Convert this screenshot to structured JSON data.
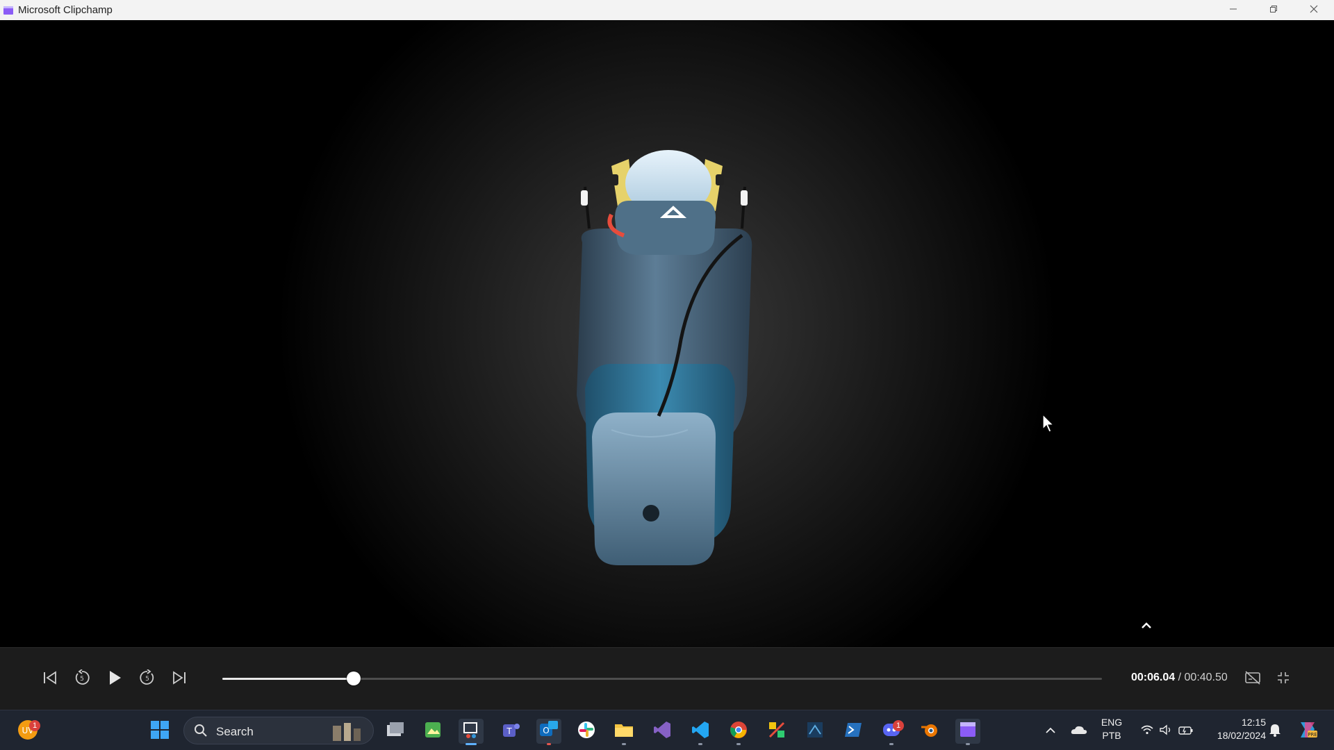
{
  "window": {
    "title": "Microsoft Clipchamp",
    "icon": "clipchamp-icon",
    "controls": [
      "minimize-icon",
      "restore-icon",
      "close-icon"
    ]
  },
  "player": {
    "current_time": "00:06.04",
    "separator": " / ",
    "total_time": "00:40.50",
    "progress": 0.149,
    "buttons": [
      "skip-back-icon",
      "rewind-5-icon",
      "play-icon",
      "forward-5-icon",
      "skip-forward-icon",
      "captions-off-icon",
      "exit-fullscreen-icon"
    ]
  },
  "taskbar": {
    "weather_badge": "1",
    "search_placeholder": "Search",
    "apps": [
      "start-icon",
      "task-view-icon",
      "photos-icon",
      "snipping-tool-icon",
      "teams-icon",
      "outlook-new-icon",
      "slack-icon",
      "file-explorer-icon",
      "visual-studio-icon",
      "vscode-icon",
      "chrome-icon",
      "kanban-icon",
      "cubeide-icon",
      "powershell-icon",
      "discord-icon",
      "blender-icon",
      "clipchamp-icon"
    ],
    "discord_badge": "1",
    "language_line1": "ENG",
    "language_line2": "PTB",
    "clock_time": "12:15",
    "clock_date": "18/02/2024"
  }
}
